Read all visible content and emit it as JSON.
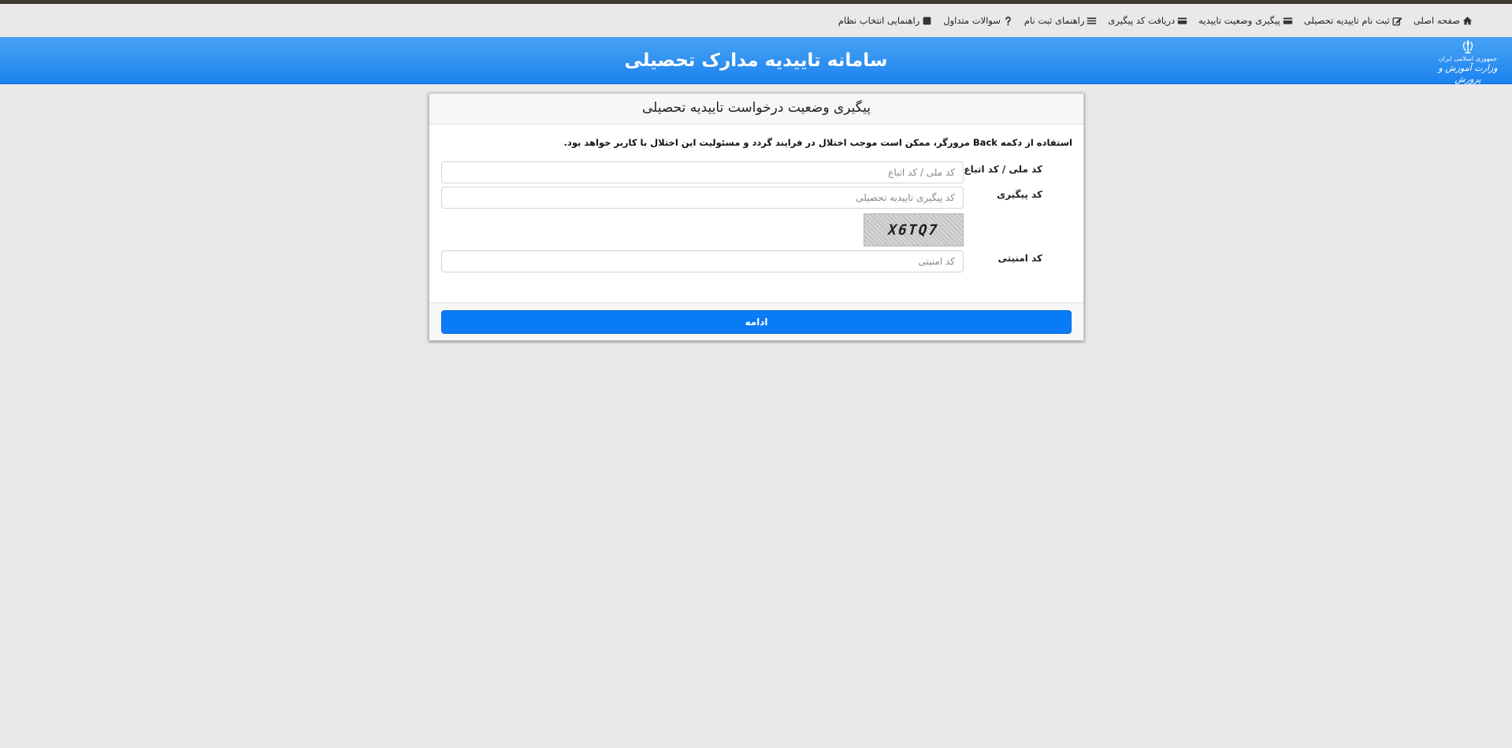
{
  "nav": {
    "items": [
      {
        "label": "صفحه اصلی",
        "icon": "home-icon"
      },
      {
        "label": "ثبت نام تاییدیه تحصیلی",
        "icon": "edit-icon"
      },
      {
        "label": "پیگیری وضعیت تاییدیه",
        "icon": "card-icon"
      },
      {
        "label": "دریافت کد پیگیری",
        "icon": "card-icon"
      },
      {
        "label": "راهنمای ثبت نام",
        "icon": "list-icon"
      },
      {
        "label": "سوالات متداول",
        "icon": "question-icon"
      },
      {
        "label": "راهنمایی انتخاب نظام",
        "icon": "book-icon"
      }
    ]
  },
  "banner": {
    "title": "سامانه تاییدیه مدارک تحصیلی",
    "logo_line1": "جمهوری اسلامی ایران",
    "logo_line2": "وزارت آموزش و پرورش"
  },
  "card": {
    "title": "پیگیری وضعیت درخواست تاییدیه تحصیلی",
    "notice": "استفاده از دکمه Back مرورگر، ممکن است موجب اختلال در فرایند گردد و مسئولیت این اختلال با کاربر خواهد بود.",
    "fields": {
      "national_code_label": "کد ملی / کد اتباع",
      "national_code_placeholder": "کد ملی / کد اتباع",
      "tracking_code_label": "کد پیگیری",
      "tracking_code_placeholder": "کد پیگیری تاییدیه تحصیلی",
      "security_code_label": "کد امنیتی",
      "security_code_placeholder": "کد امنیتی"
    },
    "captcha_text": "X6TQ7",
    "submit_label": "ادامه"
  },
  "colors": {
    "accent": "#0a7bf6",
    "banner_top": "#48a3f5",
    "banner_bottom": "#1b82ee",
    "background": "#eae9ea"
  }
}
